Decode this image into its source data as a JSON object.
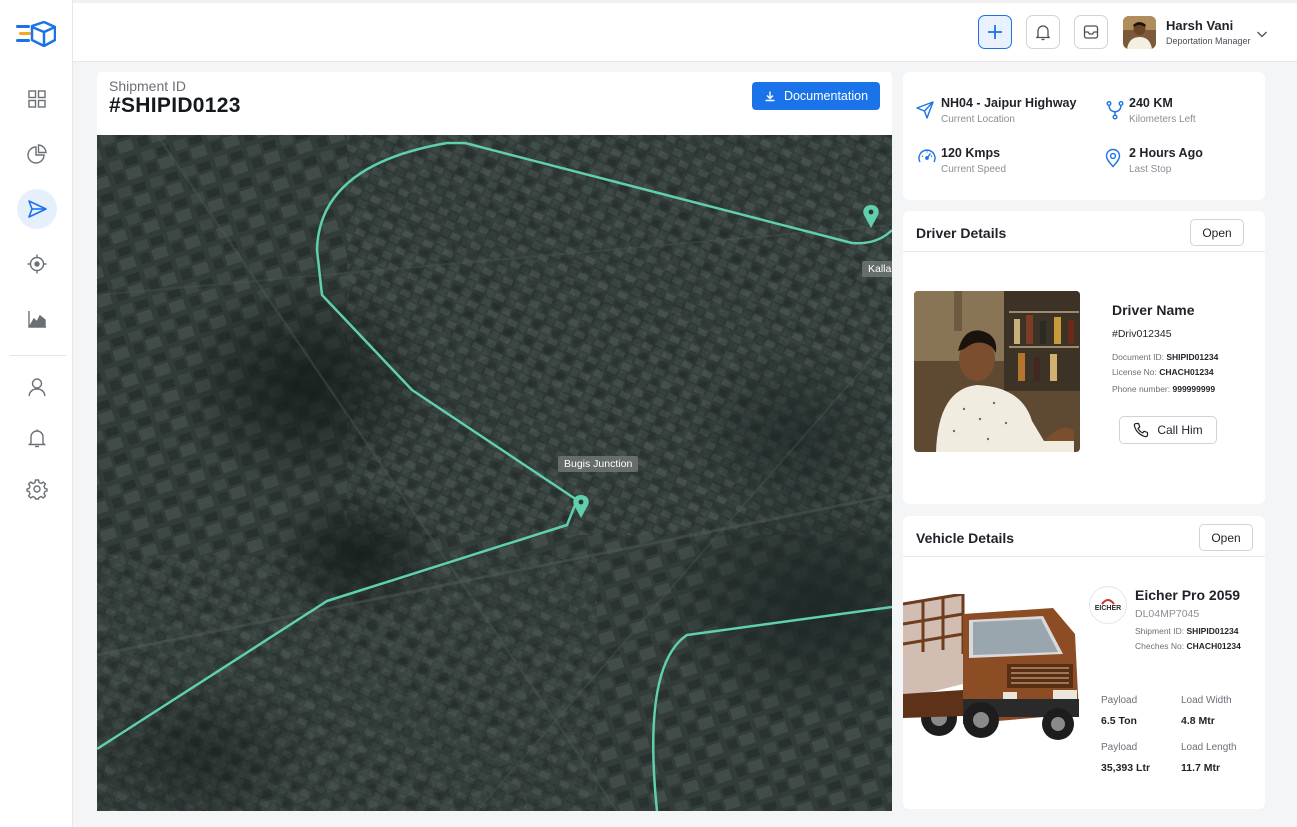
{
  "user": {
    "name": "Harsh Vani",
    "role": "Deportation Manager"
  },
  "shipment": {
    "label": "Shipment ID",
    "id": "#SHIPID0123",
    "doc_button": "Documentation"
  },
  "map": {
    "labels": {
      "bugis": "Bugis Junction",
      "kalla": "Kalla"
    },
    "route_color": "#5fcfae"
  },
  "stats": {
    "location": {
      "value": "NH04 - Jaipur Highway",
      "label": "Current Location"
    },
    "km": {
      "value": "240 KM",
      "label": "Kilometers Left"
    },
    "speed": {
      "value": "120 Kmps",
      "label": "Current Speed"
    },
    "last_stop": {
      "value": "2 Hours Ago",
      "label": "Last Stop"
    }
  },
  "driver": {
    "title": "Driver Details",
    "open": "Open",
    "name": "Driver Name",
    "id": "#Driv012345",
    "doc_label": "Document ID:",
    "doc_value": "SHIPID01234",
    "license_label": "License No:",
    "license_value": "CHACH01234",
    "phone_label": "Phone number:",
    "phone_value": "999999999",
    "call": "Call Him"
  },
  "vehicle": {
    "title": "Vehicle Details",
    "open": "Open",
    "brand": "EICHER",
    "model": "Eicher Pro 2059",
    "reg": "DL04MP7045",
    "shipment_label": "Shipment ID:",
    "shipment_value": "SHIPID01234",
    "chassis_label": "Cheches No:",
    "chassis_value": "CHACH01234",
    "specs": [
      {
        "label": "Payload",
        "value": "6.5 Ton"
      },
      {
        "label": "Load Width",
        "value": "4.8 Mtr"
      },
      {
        "label": "Payload",
        "value": "35,393 Ltr"
      },
      {
        "label": "Load Length",
        "value": "11.7 Mtr"
      }
    ]
  },
  "colors": {
    "accent": "#1a73e8",
    "sidebar_active_bg": "#e6f0fc"
  }
}
